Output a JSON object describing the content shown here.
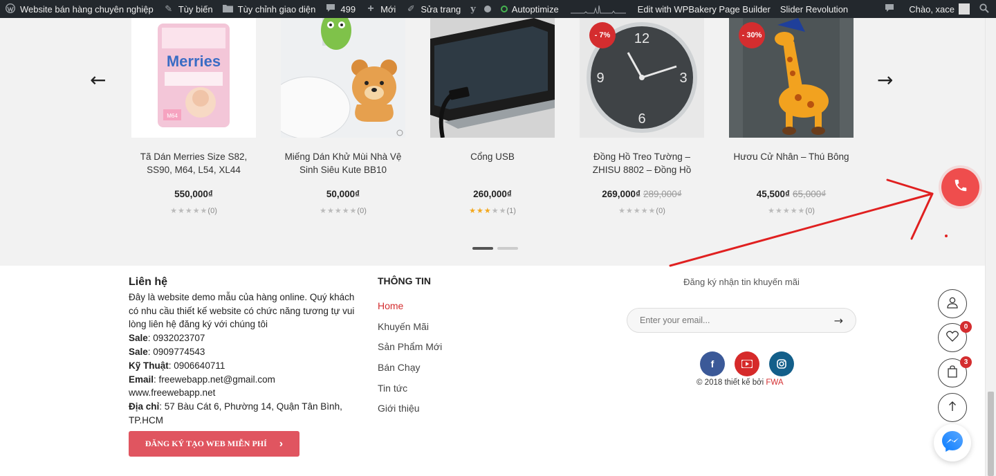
{
  "admin_bar": {
    "site_name": "Website bán hàng chuyên nghiệp",
    "customize": "Tùy biến",
    "customize_ui": "Tùy chỉnh giao diện",
    "comments_count": "499",
    "new": "Mới",
    "edit_page": "Sửa trang",
    "autoptimize": "Autoptimize",
    "wpbakery": "Edit with WPBakery Page Builder",
    "slider": "Slider Revolution",
    "greeting": "Chào, xace"
  },
  "carousel": {
    "products": [
      {
        "name": "Tã Dán Merries Size S82, SS90, M64, L54, XL44 Hàn...",
        "price": "550,000₫",
        "old_price": "",
        "badge": "",
        "rating": 0,
        "count": "(0)"
      },
      {
        "name": "Miếng Dán Khử Mùi Nhà Vệ Sinh Siêu Kute BB10",
        "price": "50,000₫",
        "old_price": "",
        "badge": "",
        "rating": 0,
        "count": "(0)"
      },
      {
        "name": "Cổng USB",
        "price": "260,000₫",
        "old_price": "",
        "badge": "",
        "rating": 3,
        "count": "(1)"
      },
      {
        "name": "Đồng Hồ Treo Tường – ZHISU 8802 – Đồng Hồ Tre...",
        "price": "269,000₫",
        "old_price": "289,000₫",
        "badge": "- 7%",
        "rating": 0,
        "count": "(0)"
      },
      {
        "name": "Hươu Cử Nhân – Thú Bông",
        "price": "45,500₫",
        "old_price": "65,000₫",
        "badge": "- 30%",
        "rating": 0,
        "count": "(0)"
      }
    ]
  },
  "contact": {
    "title": "Liên hệ",
    "description": "Đây là website demo mẫu của hàng online. Quý khách có nhu cầu thiết kế website có chức năng tương tự vui lòng liên hệ đăng ký với chúng tôi",
    "sale1_label": "Sale",
    "sale1_value": ": 0932023707",
    "sale2_label": "Sale",
    "sale2_value": ": 0909774543",
    "tech_label": "Kỹ Thuật",
    "tech_value": ": 0906640711",
    "email_label": "Email",
    "email_value": ": freewebapp.net@gmail.com",
    "website": "www.freewebapp.net",
    "address_label": "Địa chỉ",
    "address_value": ": 57 Bàu Cát 6, Phường 14, Quận Tân Bình, TP.HCM",
    "cta_label": "ĐĂNG KÝ TẠO WEB MIỄN PHÍ",
    "cta_arrow": "›"
  },
  "info": {
    "title": "THÔNG TIN",
    "links": [
      "Home",
      "Khuyến Mãi",
      "Sản Phẩm Mới",
      "Bán Chạy",
      "Tin tức",
      "Giới thiệu"
    ]
  },
  "subscribe": {
    "title": "Đăng ký nhận tin khuyến mãi",
    "placeholder": "Enter your email..."
  },
  "copyright": {
    "text": "© 2018 thiết kế bởi ",
    "brand": "FWA"
  },
  "floating": {
    "wishlist_count": "0",
    "cart_count": "3"
  },
  "colors": {
    "accent": "#d42d2f",
    "phone": "#ef4d4d",
    "admin_bar": "#23282d",
    "section_bg": "#f2f2f2",
    "annotation": "#e02020"
  },
  "icons": [
    "wordpress-icon",
    "brush-icon",
    "folder-icon",
    "comment-icon",
    "plus-icon",
    "pencil-icon",
    "yoast-icon",
    "search-icon",
    "phone-icon",
    "user-icon",
    "heart-icon",
    "bag-icon",
    "arrow-up-icon",
    "messenger-icon",
    "facebook-icon",
    "youtube-icon",
    "instagram-icon"
  ]
}
